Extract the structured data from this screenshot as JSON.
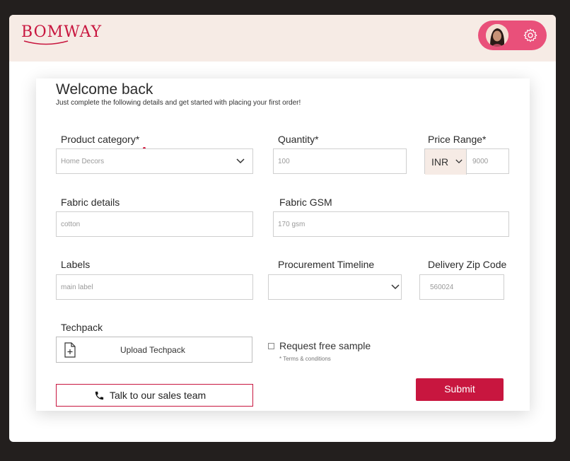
{
  "header": {
    "logo_text": "BOMWAY",
    "user_avatar": "user-avatar",
    "settings_icon": "gear-icon"
  },
  "form": {
    "welcome_title": "Welcome back",
    "subtitle": "Just complete the following details and get started with placing your first order!",
    "product_category": {
      "label": "Product category*",
      "value": "Home Decors"
    },
    "quantity": {
      "label": "Quantity*",
      "placeholder": "100"
    },
    "price_range": {
      "label": "Price Range*",
      "currency": "INR",
      "placeholder": "9000"
    },
    "fabric_details": {
      "label": "Fabric details",
      "placeholder": "cotton"
    },
    "fabric_gsm": {
      "label": "Fabric GSM",
      "placeholder": "170 gsm"
    },
    "labels": {
      "label": "Labels",
      "placeholder": "main label"
    },
    "procurement_timeline": {
      "label": "Procurement Timeline",
      "value": ""
    },
    "delivery_zip": {
      "label": "Delivery Zip Code",
      "placeholder": "560024"
    },
    "techpack": {
      "label": "Techpack",
      "upload_label": "Upload Techpack"
    },
    "free_sample": {
      "label": "Request free sample",
      "terms": "* Terms & conditions",
      "checked": false
    },
    "sales_button": "Talk to our sales team",
    "submit_button": "Submit"
  },
  "colors": {
    "brand": "#c8163f",
    "header_bg": "#f6ebe5",
    "pill_bg": "#e9507a",
    "background": "#231f1e"
  }
}
